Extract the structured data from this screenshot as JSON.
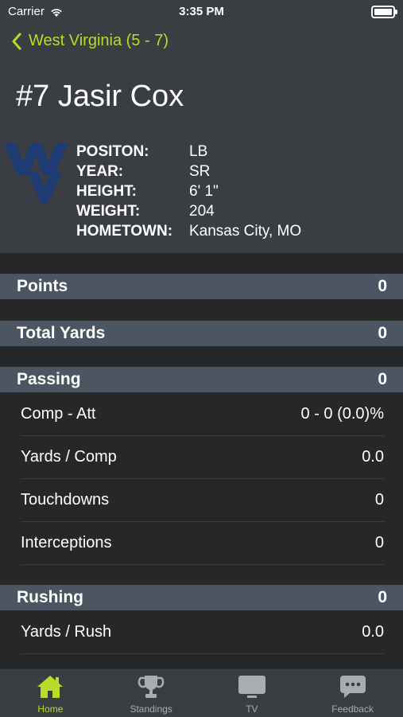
{
  "status_bar": {
    "carrier": "Carrier",
    "time": "3:35 PM"
  },
  "nav": {
    "back_label": "West Virginia (5 - 7)"
  },
  "player": {
    "name": "#7 Jasir Cox",
    "logo_icon": "wvu-logo",
    "fields": [
      {
        "label": "POSITON:",
        "value": "LB"
      },
      {
        "label": "YEAR:",
        "value": "SR"
      },
      {
        "label": "HEIGHT:",
        "value": "6' 1\""
      },
      {
        "label": "WEIGHT:",
        "value": "204"
      },
      {
        "label": "HOMETOWN:",
        "value": "Kansas City, MO"
      }
    ]
  },
  "sections": {
    "points": {
      "title": "Points",
      "value": "0"
    },
    "total_yards": {
      "title": "Total Yards",
      "value": "0"
    },
    "passing": {
      "title": "Passing",
      "value": "0",
      "rows": [
        {
          "label": "Comp - Att",
          "value": "0 - 0 (0.0)%"
        },
        {
          "label": "Yards / Comp",
          "value": "0.0"
        },
        {
          "label": "Touchdowns",
          "value": "0"
        },
        {
          "label": "Interceptions",
          "value": "0"
        }
      ]
    },
    "rushing": {
      "title": "Rushing",
      "value": "0",
      "rows": [
        {
          "label": "Yards / Rush",
          "value": "0.0"
        }
      ]
    }
  },
  "tabs": [
    {
      "label": "Home",
      "icon": "home-icon"
    },
    {
      "label": "Standings",
      "icon": "trophy-icon"
    },
    {
      "label": "TV",
      "icon": "tv-icon"
    },
    {
      "label": "Feedback",
      "icon": "chat-bubble-icon"
    }
  ],
  "colors": {
    "accent": "#b9dc29",
    "header_bg": "#3a3d41",
    "section_bg": "#4b5662",
    "page_bg": "#262729",
    "logo": "#1f3b73"
  }
}
